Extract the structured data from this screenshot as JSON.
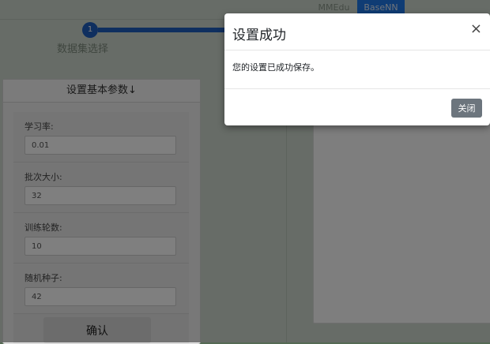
{
  "topbar": {
    "tabs": [
      {
        "label": "MMEdu"
      },
      {
        "label": "BaseNN"
      }
    ]
  },
  "stepper": {
    "step_number": "1",
    "step_label": "数据集选择"
  },
  "params_panel": {
    "title": "设置基本参数↓",
    "fields": [
      {
        "label": "学习率:",
        "value": "0.01"
      },
      {
        "label": "批次大小:",
        "value": "32"
      },
      {
        "label": "训练轮数:",
        "value": "10"
      },
      {
        "label": "随机种子:",
        "value": "42"
      }
    ],
    "confirm_label": "确认"
  },
  "modal": {
    "title": "设置成功",
    "close_icon": "×",
    "message": "您的设置已成功保存。",
    "close_label": "关闭"
  }
}
